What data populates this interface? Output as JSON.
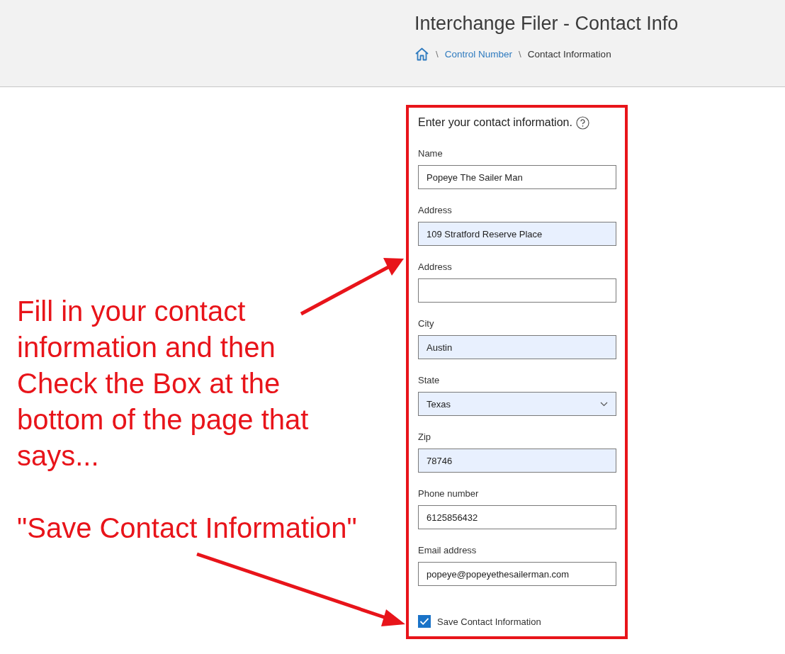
{
  "header": {
    "title": "Interchange Filer - Contact Info",
    "breadcrumb": [
      {
        "kind": "home"
      },
      {
        "kind": "separator",
        "text": "\\"
      },
      {
        "kind": "link",
        "text": "Control Number"
      },
      {
        "kind": "separator",
        "text": "\\"
      },
      {
        "kind": "current",
        "text": "Contact Information"
      }
    ]
  },
  "form": {
    "heading": "Enter your contact information.",
    "fields": [
      {
        "kind": "text",
        "label": "Name",
        "value": "Popeye The Sailer Man",
        "autofilled": false
      },
      {
        "kind": "text",
        "label": "Address",
        "value": "109 Stratford Reserve Place",
        "autofilled": true
      },
      {
        "kind": "text",
        "label": "Address",
        "autofilled": false
      },
      {
        "kind": "text",
        "label": "City",
        "value": "Austin",
        "autofilled": true
      },
      {
        "kind": "select",
        "label": "State",
        "value": "Texas",
        "autofilled": true
      },
      {
        "kind": "text",
        "label": "Zip",
        "value": "78746",
        "autofilled": true
      },
      {
        "kind": "text",
        "label": "Phone number",
        "value": "6125856432",
        "autofilled": false
      },
      {
        "kind": "text",
        "label": "Email address",
        "value": "popeye@popeyethesailerman.com",
        "autofilled": false
      }
    ],
    "checkbox": {
      "label": "Save Contact Information",
      "checked": true
    }
  },
  "annotations": [
    {
      "text": "Fill in your contact information and then Check the Box at the bottom of the page that says..."
    },
    {
      "text": "\"Save Contact Information\""
    }
  ]
}
